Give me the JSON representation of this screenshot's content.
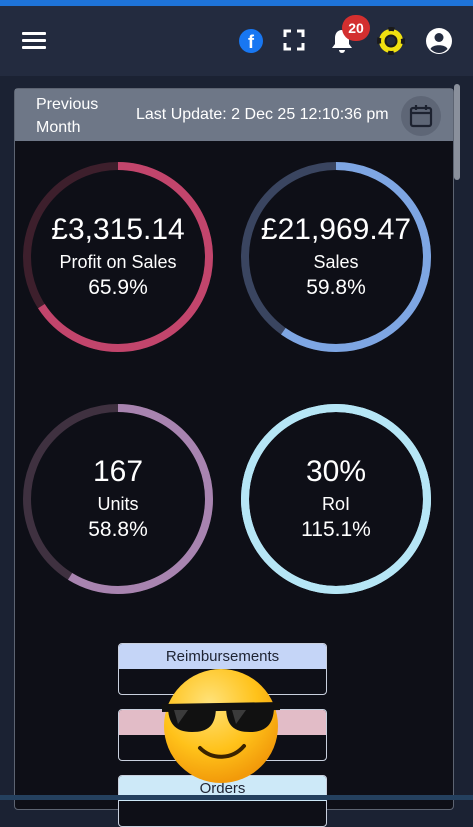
{
  "topbar": {
    "menu_icon": "hamburger-icon",
    "social_icon": "facebook-icon",
    "social_glyph": "f",
    "fullscreen_icon": "fullscreen-icon",
    "notifications_icon": "bell-icon",
    "notifications_count": "20",
    "help_icon": "lifebuoy-icon",
    "account_icon": "account-circle-icon"
  },
  "dashboard": {
    "period": "Previous Month",
    "last_update": "Last Update: 2 Dec 25 12:10:36 pm",
    "calendar_icon": "calendar-icon"
  },
  "gauges": [
    {
      "value": "£3,315.14",
      "label": "Profit on Sales",
      "percent_text": "65.9%",
      "fill_fraction": 0.659,
      "color": "#c2456c",
      "track": "#3d1f2c"
    },
    {
      "value": "£21,969.47",
      "label": "Sales",
      "percent_text": "59.8%",
      "fill_fraction": 0.598,
      "color": "#7ea6e3",
      "track": "#3a4560"
    },
    {
      "value": "167",
      "label": "Units",
      "percent_text": "58.8%",
      "fill_fraction": 0.588,
      "color": "#a884b0",
      "track": "#3f3140"
    },
    {
      "value": "30%",
      "label": "RoI",
      "percent_text": "115.1%",
      "fill_fraction": 1.0,
      "color": "#b6e6f6",
      "track": "#b6e6f6"
    }
  ],
  "cards": [
    {
      "title": "Reimbursements",
      "header_color": "#c5d5f7"
    },
    {
      "title": "",
      "header_color": "#e2bcc7"
    },
    {
      "title": "Orders",
      "header_color": "#cde9f8"
    }
  ],
  "overlay": {
    "emoji": "smiling-face-with-sunglasses"
  }
}
